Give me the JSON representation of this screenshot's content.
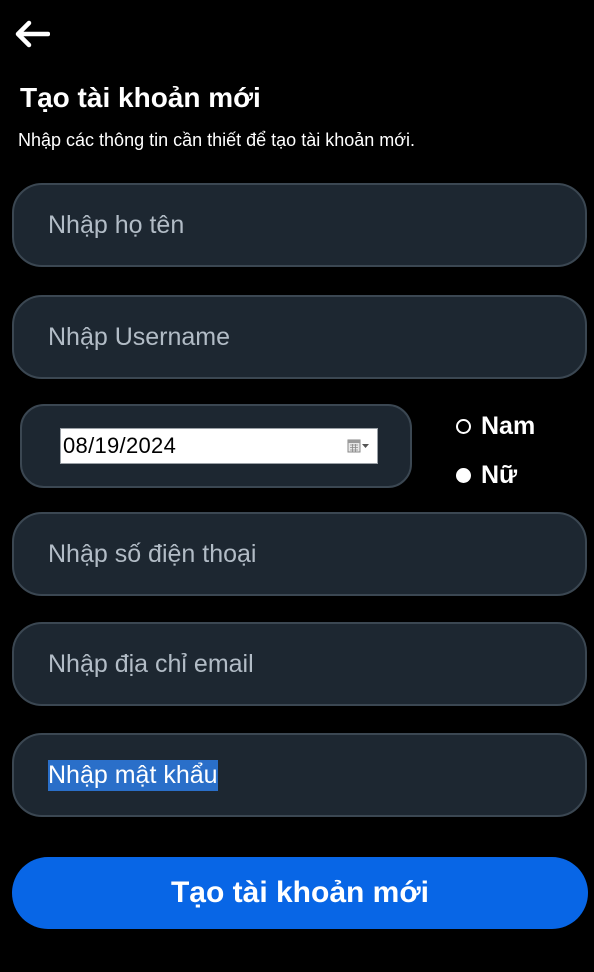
{
  "header": {
    "back_icon": "arrow-left-icon",
    "title": "Tạo tài khoản mới",
    "subtitle": "Nhập các thông tin cần thiết để tạo tài khoản mới."
  },
  "form": {
    "fullname_placeholder": "Nhập họ tên",
    "username_placeholder": "Nhập Username",
    "birthdate_value": "08/19/2024",
    "calendar_icon": "calendar-dropdown-icon",
    "gender": {
      "options": [
        {
          "label": "Nam",
          "selected": false
        },
        {
          "label": "Nữ",
          "selected": true
        }
      ]
    },
    "phone_placeholder": "Nhập số điện thoại",
    "email_placeholder": "Nhập địa chỉ email",
    "password_text": "Nhập mật khẩu"
  },
  "submit": {
    "label": "Tạo tài khoản mới"
  },
  "colors": {
    "background": "#000000",
    "field_bg": "#1d2731",
    "field_border": "#3b4752",
    "placeholder": "#b2bcc6",
    "accent": "#0866e6",
    "selection": "#2a6fc9"
  }
}
